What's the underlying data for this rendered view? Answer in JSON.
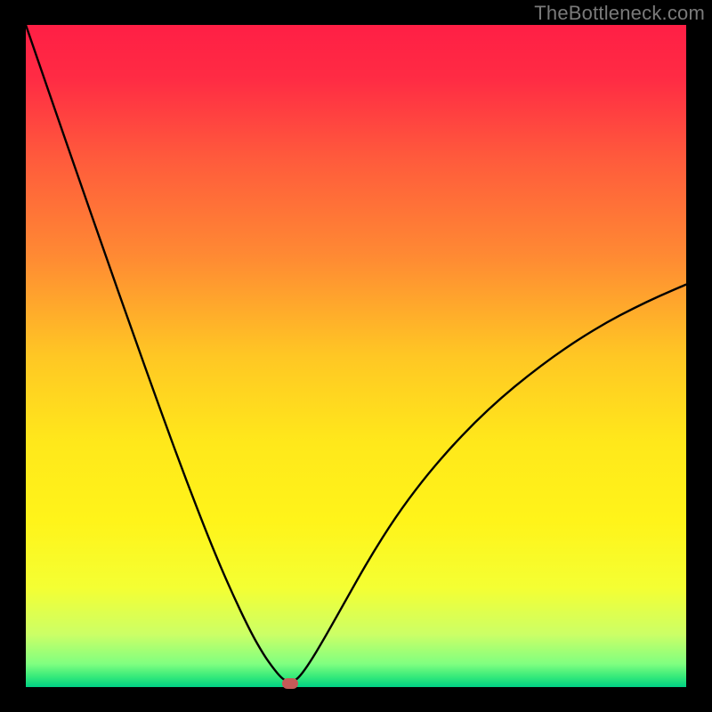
{
  "watermark": "TheBottleneck.com",
  "chart_data": {
    "type": "line",
    "title": "",
    "xlabel": "",
    "ylabel": "",
    "xlim": [
      0,
      100
    ],
    "ylim": [
      0,
      100
    ],
    "background": {
      "gradient_stops": [
        {
          "pos": 0.0,
          "color": "#ff1f45"
        },
        {
          "pos": 0.08,
          "color": "#ff2b44"
        },
        {
          "pos": 0.2,
          "color": "#ff5a3c"
        },
        {
          "pos": 0.35,
          "color": "#ff8a33"
        },
        {
          "pos": 0.5,
          "color": "#ffc724"
        },
        {
          "pos": 0.63,
          "color": "#ffe81b"
        },
        {
          "pos": 0.75,
          "color": "#fff41a"
        },
        {
          "pos": 0.85,
          "color": "#f4ff33"
        },
        {
          "pos": 0.92,
          "color": "#ccff66"
        },
        {
          "pos": 0.965,
          "color": "#80ff80"
        },
        {
          "pos": 0.985,
          "color": "#33e97a"
        },
        {
          "pos": 1.0,
          "color": "#00d084"
        }
      ]
    },
    "series": [
      {
        "name": "bottleneck-curve",
        "x": [
          0,
          2,
          5,
          8,
          12,
          16,
          20,
          24,
          28,
          31,
          34,
          36,
          37.5,
          38.6,
          39.4,
          40,
          40.5,
          41.5,
          43,
          45,
          48,
          52,
          56,
          60,
          64,
          68,
          72,
          76,
          80,
          84,
          88,
          92,
          96,
          100
        ],
        "y": [
          100,
          94.2,
          85.5,
          76.9,
          65.4,
          54.1,
          42.9,
          32.0,
          21.7,
          14.7,
          8.4,
          4.9,
          2.8,
          1.5,
          0.9,
          0.6,
          0.8,
          1.6,
          3.7,
          7.0,
          12.3,
          19.4,
          25.7,
          31.1,
          35.8,
          40.0,
          43.7,
          47.0,
          50.0,
          52.7,
          55.1,
          57.2,
          59.1,
          60.8
        ]
      }
    ],
    "marker": {
      "x": 40,
      "y": 0.6,
      "color": "#c55a58"
    }
  }
}
